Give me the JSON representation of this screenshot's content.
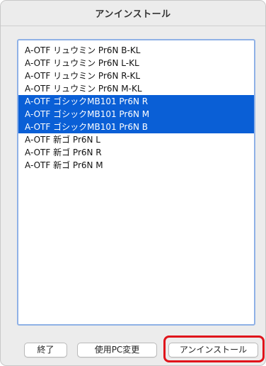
{
  "window": {
    "title": "アンインストール"
  },
  "font_list": {
    "items": [
      {
        "label": "A-OTF リュウミン Pr6N B-KL",
        "selected": false
      },
      {
        "label": "A-OTF リュウミン Pr6N L-KL",
        "selected": false
      },
      {
        "label": "A-OTF リュウミン Pr6N R-KL",
        "selected": false
      },
      {
        "label": "A-OTF リュウミン Pr6N M-KL",
        "selected": false
      },
      {
        "label": "A-OTF ゴシックMB101 Pr6N R",
        "selected": true
      },
      {
        "label": "A-OTF ゴシックMB101 Pr6N M",
        "selected": true
      },
      {
        "label": "A-OTF ゴシックMB101 Pr6N B",
        "selected": true
      },
      {
        "label": "A-OTF 新ゴ Pr6N L",
        "selected": false
      },
      {
        "label": "A-OTF 新ゴ Pr6N R",
        "selected": false
      },
      {
        "label": "A-OTF 新ゴ Pr6N M",
        "selected": false
      }
    ]
  },
  "buttons": {
    "quit_label": "終了",
    "change_pc_label": "使用PC変更",
    "uninstall_label": "アンインストール"
  },
  "colors": {
    "selection": "#0a5fd6",
    "list_border": "#8fb1e6",
    "highlight_ring": "#e0141b",
    "window_bg": "#ececec"
  }
}
